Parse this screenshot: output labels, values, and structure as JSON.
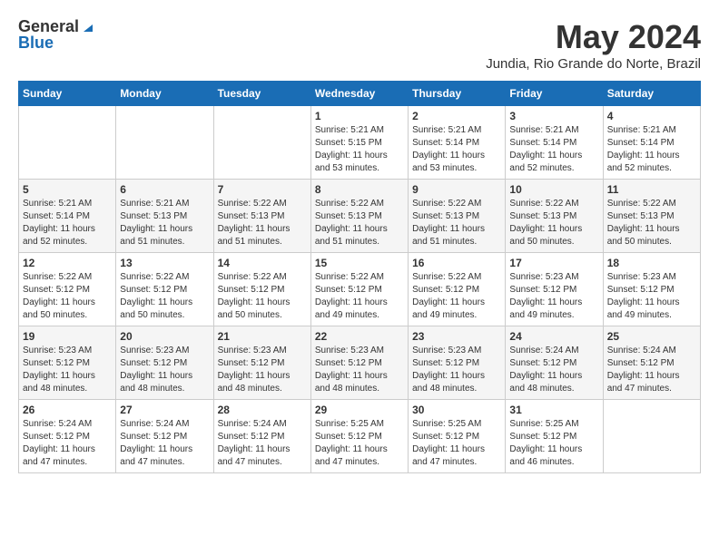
{
  "header": {
    "logo_general": "General",
    "logo_blue": "Blue",
    "month_title": "May 2024",
    "location": "Jundia, Rio Grande do Norte, Brazil"
  },
  "weekdays": [
    "Sunday",
    "Monday",
    "Tuesday",
    "Wednesday",
    "Thursday",
    "Friday",
    "Saturday"
  ],
  "weeks": [
    [
      {
        "day": "",
        "sunrise": "",
        "sunset": "",
        "daylight": ""
      },
      {
        "day": "",
        "sunrise": "",
        "sunset": "",
        "daylight": ""
      },
      {
        "day": "",
        "sunrise": "",
        "sunset": "",
        "daylight": ""
      },
      {
        "day": "1",
        "sunrise": "Sunrise: 5:21 AM",
        "sunset": "Sunset: 5:15 PM",
        "daylight": "Daylight: 11 hours and 53 minutes."
      },
      {
        "day": "2",
        "sunrise": "Sunrise: 5:21 AM",
        "sunset": "Sunset: 5:14 PM",
        "daylight": "Daylight: 11 hours and 53 minutes."
      },
      {
        "day": "3",
        "sunrise": "Sunrise: 5:21 AM",
        "sunset": "Sunset: 5:14 PM",
        "daylight": "Daylight: 11 hours and 52 minutes."
      },
      {
        "day": "4",
        "sunrise": "Sunrise: 5:21 AM",
        "sunset": "Sunset: 5:14 PM",
        "daylight": "Daylight: 11 hours and 52 minutes."
      }
    ],
    [
      {
        "day": "5",
        "sunrise": "Sunrise: 5:21 AM",
        "sunset": "Sunset: 5:14 PM",
        "daylight": "Daylight: 11 hours and 52 minutes."
      },
      {
        "day": "6",
        "sunrise": "Sunrise: 5:21 AM",
        "sunset": "Sunset: 5:13 PM",
        "daylight": "Daylight: 11 hours and 51 minutes."
      },
      {
        "day": "7",
        "sunrise": "Sunrise: 5:22 AM",
        "sunset": "Sunset: 5:13 PM",
        "daylight": "Daylight: 11 hours and 51 minutes."
      },
      {
        "day": "8",
        "sunrise": "Sunrise: 5:22 AM",
        "sunset": "Sunset: 5:13 PM",
        "daylight": "Daylight: 11 hours and 51 minutes."
      },
      {
        "day": "9",
        "sunrise": "Sunrise: 5:22 AM",
        "sunset": "Sunset: 5:13 PM",
        "daylight": "Daylight: 11 hours and 51 minutes."
      },
      {
        "day": "10",
        "sunrise": "Sunrise: 5:22 AM",
        "sunset": "Sunset: 5:13 PM",
        "daylight": "Daylight: 11 hours and 50 minutes."
      },
      {
        "day": "11",
        "sunrise": "Sunrise: 5:22 AM",
        "sunset": "Sunset: 5:13 PM",
        "daylight": "Daylight: 11 hours and 50 minutes."
      }
    ],
    [
      {
        "day": "12",
        "sunrise": "Sunrise: 5:22 AM",
        "sunset": "Sunset: 5:12 PM",
        "daylight": "Daylight: 11 hours and 50 minutes."
      },
      {
        "day": "13",
        "sunrise": "Sunrise: 5:22 AM",
        "sunset": "Sunset: 5:12 PM",
        "daylight": "Daylight: 11 hours and 50 minutes."
      },
      {
        "day": "14",
        "sunrise": "Sunrise: 5:22 AM",
        "sunset": "Sunset: 5:12 PM",
        "daylight": "Daylight: 11 hours and 50 minutes."
      },
      {
        "day": "15",
        "sunrise": "Sunrise: 5:22 AM",
        "sunset": "Sunset: 5:12 PM",
        "daylight": "Daylight: 11 hours and 49 minutes."
      },
      {
        "day": "16",
        "sunrise": "Sunrise: 5:22 AM",
        "sunset": "Sunset: 5:12 PM",
        "daylight": "Daylight: 11 hours and 49 minutes."
      },
      {
        "day": "17",
        "sunrise": "Sunrise: 5:23 AM",
        "sunset": "Sunset: 5:12 PM",
        "daylight": "Daylight: 11 hours and 49 minutes."
      },
      {
        "day": "18",
        "sunrise": "Sunrise: 5:23 AM",
        "sunset": "Sunset: 5:12 PM",
        "daylight": "Daylight: 11 hours and 49 minutes."
      }
    ],
    [
      {
        "day": "19",
        "sunrise": "Sunrise: 5:23 AM",
        "sunset": "Sunset: 5:12 PM",
        "daylight": "Daylight: 11 hours and 48 minutes."
      },
      {
        "day": "20",
        "sunrise": "Sunrise: 5:23 AM",
        "sunset": "Sunset: 5:12 PM",
        "daylight": "Daylight: 11 hours and 48 minutes."
      },
      {
        "day": "21",
        "sunrise": "Sunrise: 5:23 AM",
        "sunset": "Sunset: 5:12 PM",
        "daylight": "Daylight: 11 hours and 48 minutes."
      },
      {
        "day": "22",
        "sunrise": "Sunrise: 5:23 AM",
        "sunset": "Sunset: 5:12 PM",
        "daylight": "Daylight: 11 hours and 48 minutes."
      },
      {
        "day": "23",
        "sunrise": "Sunrise: 5:23 AM",
        "sunset": "Sunset: 5:12 PM",
        "daylight": "Daylight: 11 hours and 48 minutes."
      },
      {
        "day": "24",
        "sunrise": "Sunrise: 5:24 AM",
        "sunset": "Sunset: 5:12 PM",
        "daylight": "Daylight: 11 hours and 48 minutes."
      },
      {
        "day": "25",
        "sunrise": "Sunrise: 5:24 AM",
        "sunset": "Sunset: 5:12 PM",
        "daylight": "Daylight: 11 hours and 47 minutes."
      }
    ],
    [
      {
        "day": "26",
        "sunrise": "Sunrise: 5:24 AM",
        "sunset": "Sunset: 5:12 PM",
        "daylight": "Daylight: 11 hours and 47 minutes."
      },
      {
        "day": "27",
        "sunrise": "Sunrise: 5:24 AM",
        "sunset": "Sunset: 5:12 PM",
        "daylight": "Daylight: 11 hours and 47 minutes."
      },
      {
        "day": "28",
        "sunrise": "Sunrise: 5:24 AM",
        "sunset": "Sunset: 5:12 PM",
        "daylight": "Daylight: 11 hours and 47 minutes."
      },
      {
        "day": "29",
        "sunrise": "Sunrise: 5:25 AM",
        "sunset": "Sunset: 5:12 PM",
        "daylight": "Daylight: 11 hours and 47 minutes."
      },
      {
        "day": "30",
        "sunrise": "Sunrise: 5:25 AM",
        "sunset": "Sunset: 5:12 PM",
        "daylight": "Daylight: 11 hours and 47 minutes."
      },
      {
        "day": "31",
        "sunrise": "Sunrise: 5:25 AM",
        "sunset": "Sunset: 5:12 PM",
        "daylight": "Daylight: 11 hours and 46 minutes."
      },
      {
        "day": "",
        "sunrise": "",
        "sunset": "",
        "daylight": ""
      }
    ]
  ]
}
